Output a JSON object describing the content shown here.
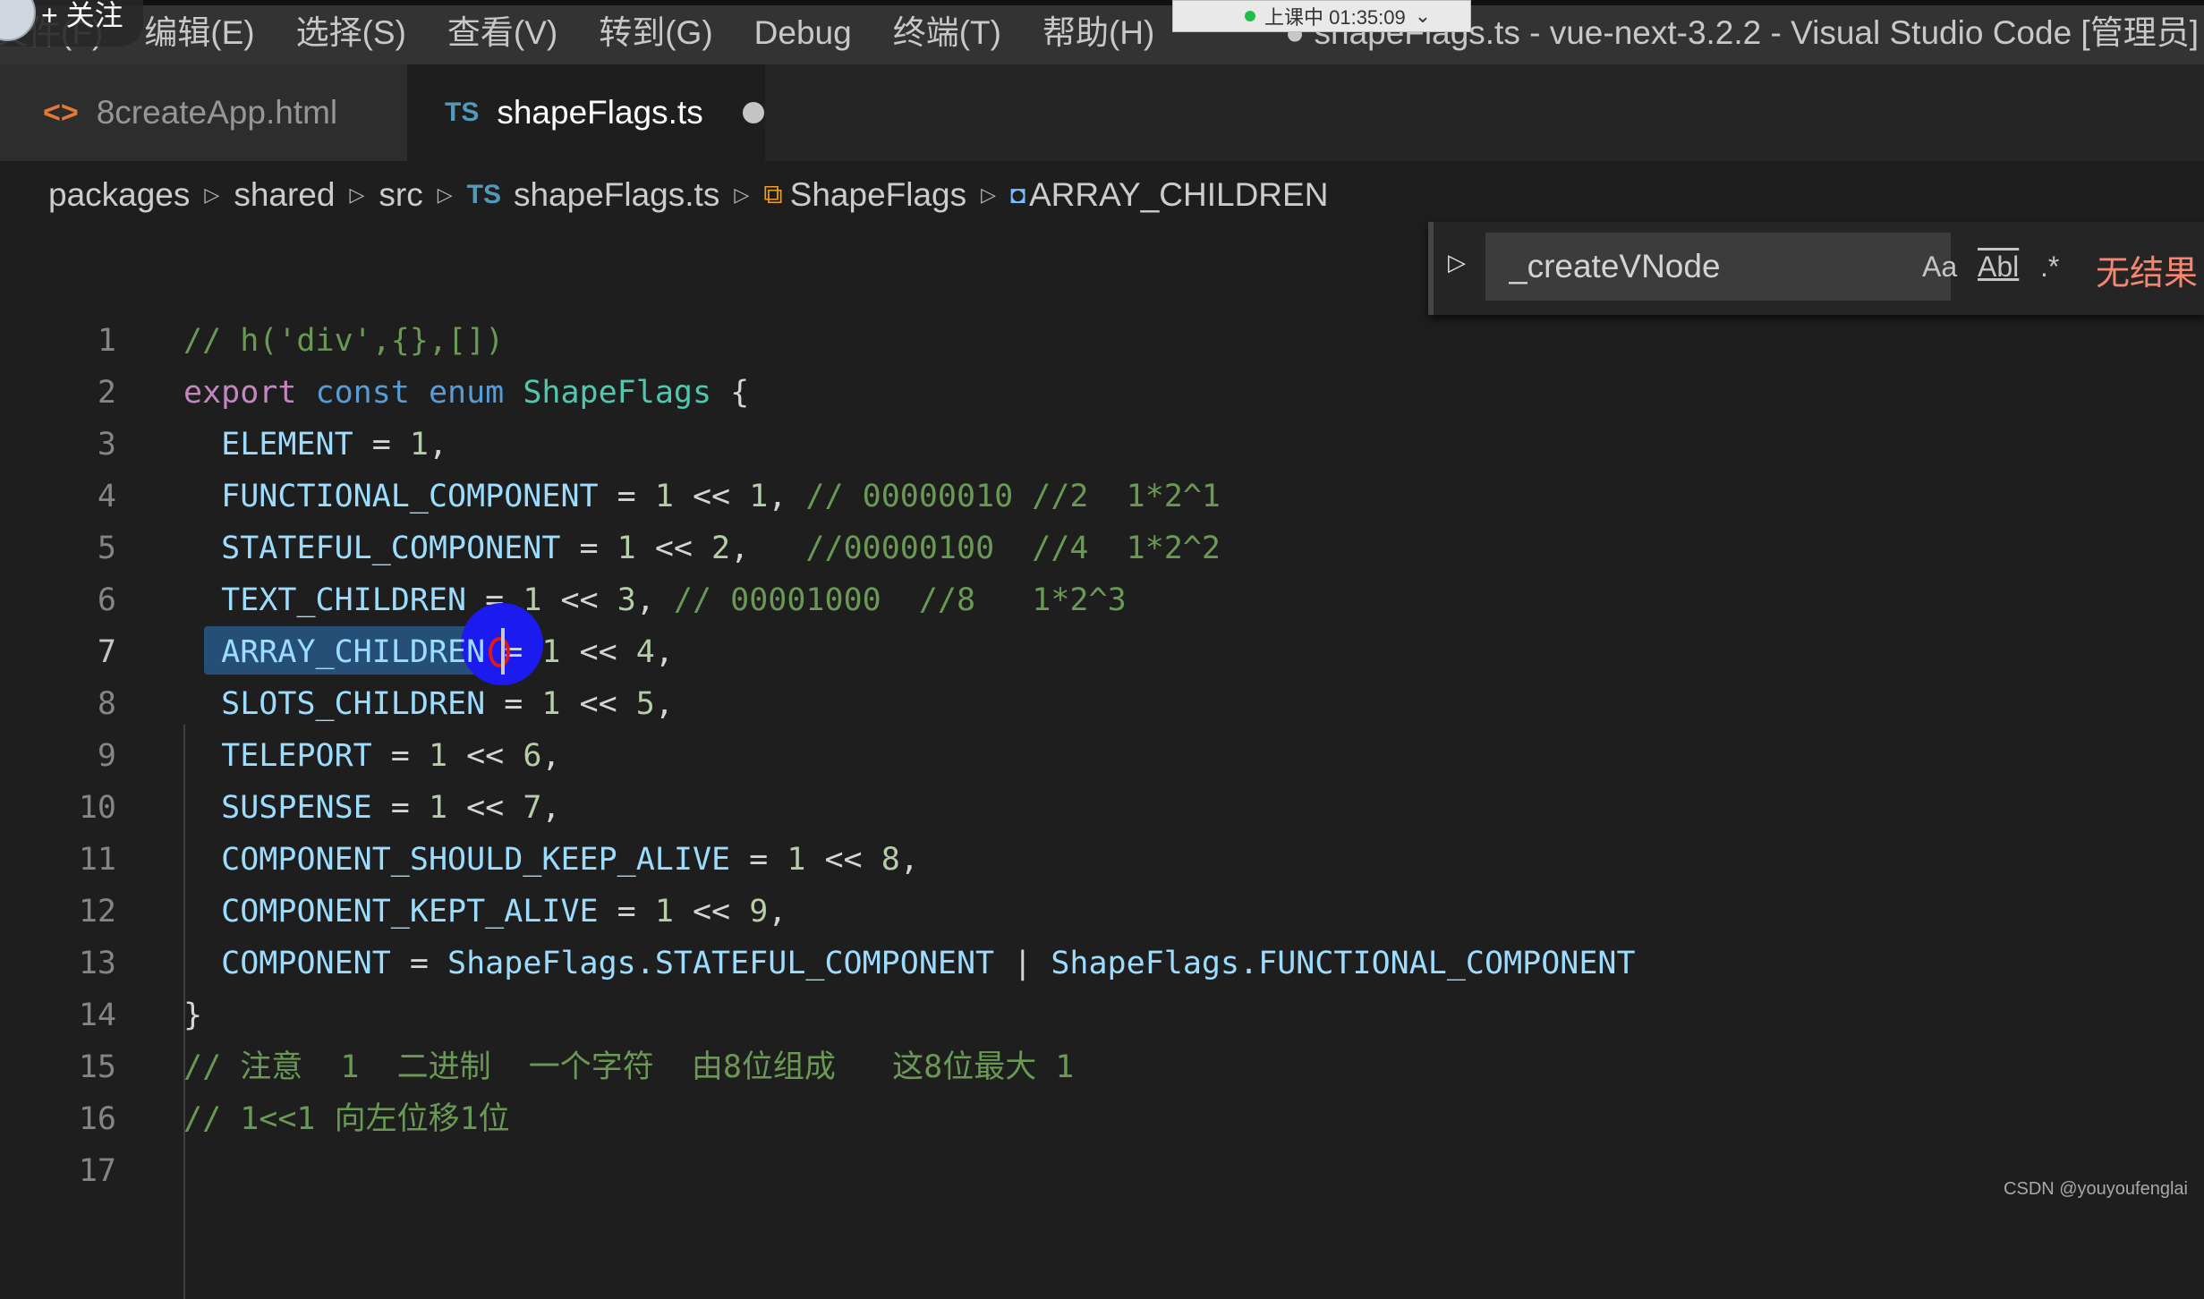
{
  "overlay": {
    "follow_label": "+ 关注"
  },
  "menubar": {
    "items": [
      "文件(F)",
      "编辑(E)",
      "选择(S)",
      "查看(V)",
      "转到(G)",
      "Debug",
      "终端(T)",
      "帮助(H)"
    ]
  },
  "meeting_badge": {
    "status": "上课中 01:35:09",
    "chevron": "⌄"
  },
  "window_title": "● shapeFlags.ts - vue-next-3.2.2 - Visual Studio Code [管理员]",
  "tabs": [
    {
      "icon": "<>",
      "label": "8createApp.html",
      "active": false
    },
    {
      "icon": "TS",
      "label": "shapeFlags.ts",
      "active": true,
      "dirty": true
    }
  ],
  "breadcrumb": {
    "items": [
      "packages",
      "shared",
      "src",
      "shapeFlags.ts",
      "ShapeFlags",
      "ARRAY_CHILDREN"
    ],
    "ts_icon": "TS",
    "separator": "▷"
  },
  "find": {
    "toggle_icon": "▷",
    "value": "_createVNode",
    "match_case": "Aa",
    "whole_word": "Abl",
    "regex": ".*",
    "result": "无结果"
  },
  "editor": {
    "lines": [
      {
        "n": "1"
      },
      {
        "n": "2"
      },
      {
        "n": "3"
      },
      {
        "n": "4"
      },
      {
        "n": "5"
      },
      {
        "n": "6"
      },
      {
        "n": "7"
      },
      {
        "n": "8"
      },
      {
        "n": "9"
      },
      {
        "n": "10"
      },
      {
        "n": "11"
      },
      {
        "n": "12"
      },
      {
        "n": "13"
      },
      {
        "n": "14"
      },
      {
        "n": "15"
      },
      {
        "n": "16"
      },
      {
        "n": "17"
      }
    ],
    "tokens": {
      "l1": "// h('div',{},[])",
      "l2_export": "export",
      "l2_const": "const",
      "l2_enum": "enum",
      "l2_name": "ShapeFlags",
      "l2_brace": "{",
      "l3_name": "ELEMENT",
      "l3_val": "1",
      "l4_name": "FUNCTIONAL_COMPONENT",
      "l4_shift": "1",
      "l4_val": "1",
      "l4_comment": "// 00000010 //2  1*2^1",
      "l5_name": "STATEFUL_COMPONENT",
      "l5_shift": "1",
      "l5_val": "2",
      "l5_comment": "//00000100  //4  1*2^2",
      "l6_name": "TEXT_CHILDREN",
      "l6_shift": "1",
      "l6_val": "3",
      "l6_comment": "// 00001000  //8   1*2^3",
      "l7_name": "ARRAY_CHILDREN",
      "l7_shift": "1",
      "l7_val": "4",
      "l8_name": "SLOTS_CHILDREN",
      "l8_shift": "1",
      "l8_val": "5",
      "l9_name": "TELEPORT",
      "l9_shift": "1",
      "l9_val": "6",
      "l10_name": "SUSPENSE",
      "l10_shift": "1",
      "l10_val": "7",
      "l11_name": "COMPONENT_SHOULD_KEEP_ALIVE",
      "l11_shift": "1",
      "l11_val": "8",
      "l12_name": "COMPONENT_KEPT_ALIVE",
      "l12_shift": "1",
      "l12_val": "9",
      "l13_name": "COMPONENT",
      "l13_a": "ShapeFlags.STATEFUL_COMPONENT",
      "l13_b": "ShapeFlags.FUNCTIONAL_COMPONENT",
      "l14": "}",
      "l15": "// 注意  1  二进制  一个字符  由8位组成   这8位最大 1",
      "l16": "// 1<<1 向左位移1位"
    }
  },
  "watermark": "CSDN @youyoufenglai"
}
